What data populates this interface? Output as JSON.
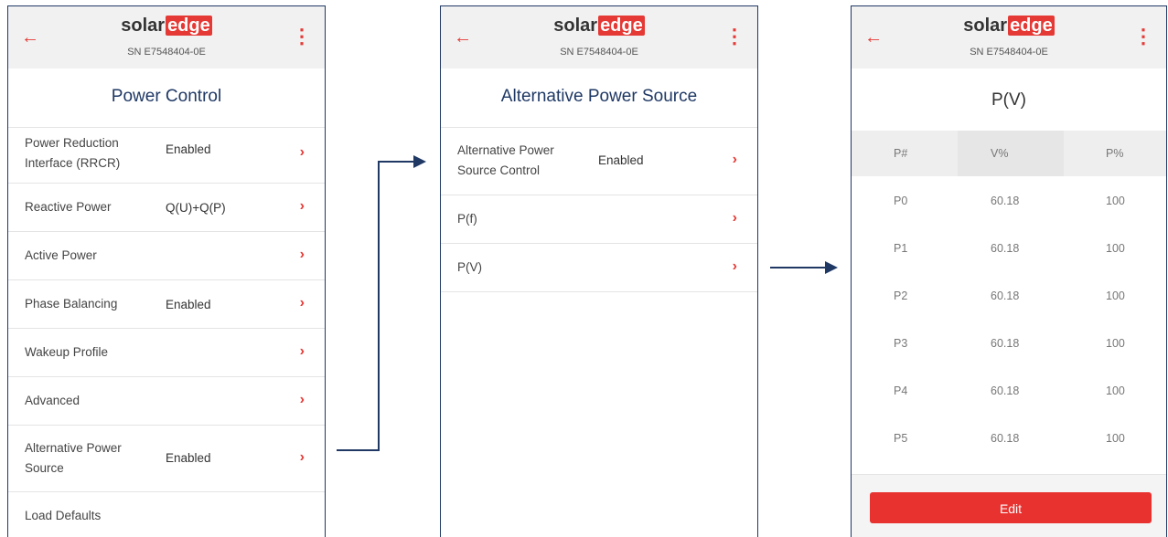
{
  "brand": {
    "solar": "solar",
    "edge": "edge",
    "sn": "SN E7548404-0E"
  },
  "colors": {
    "accent": "#e53935",
    "border": "#1f3864",
    "title": "#1f3864"
  },
  "icons": {
    "back": "←",
    "menu": "⋮",
    "chevron": "›"
  },
  "screen1": {
    "title": "Power Control",
    "items": [
      {
        "label": "Power Reduction Interface (RRCR)",
        "value": "Enabled"
      },
      {
        "label": "Reactive Power",
        "value": "Q(U)+Q(P)"
      },
      {
        "label": "Active Power",
        "value": ""
      },
      {
        "label": "Phase Balancing",
        "value": "Enabled"
      },
      {
        "label": "Wakeup Profile",
        "value": ""
      },
      {
        "label": "Advanced",
        "value": ""
      },
      {
        "label": "Alternative Power Source",
        "value": "Enabled"
      },
      {
        "label": "Load Defaults",
        "value": ""
      }
    ]
  },
  "screen2": {
    "title": "Alternative Power Source",
    "items": [
      {
        "label": "Alternative Power Source Control",
        "value": "Enabled"
      },
      {
        "label": "P(f)",
        "value": ""
      },
      {
        "label": "P(V)",
        "value": ""
      }
    ]
  },
  "screen3": {
    "title": "P(V)",
    "headers": [
      "P#",
      "V%",
      "P%"
    ],
    "rows": [
      [
        "P0",
        "60.18",
        "100"
      ],
      [
        "P1",
        "60.18",
        "100"
      ],
      [
        "P2",
        "60.18",
        "100"
      ],
      [
        "P3",
        "60.18",
        "100"
      ],
      [
        "P4",
        "60.18",
        "100"
      ],
      [
        "P5",
        "60.18",
        "100"
      ]
    ],
    "edit_label": "Edit"
  }
}
